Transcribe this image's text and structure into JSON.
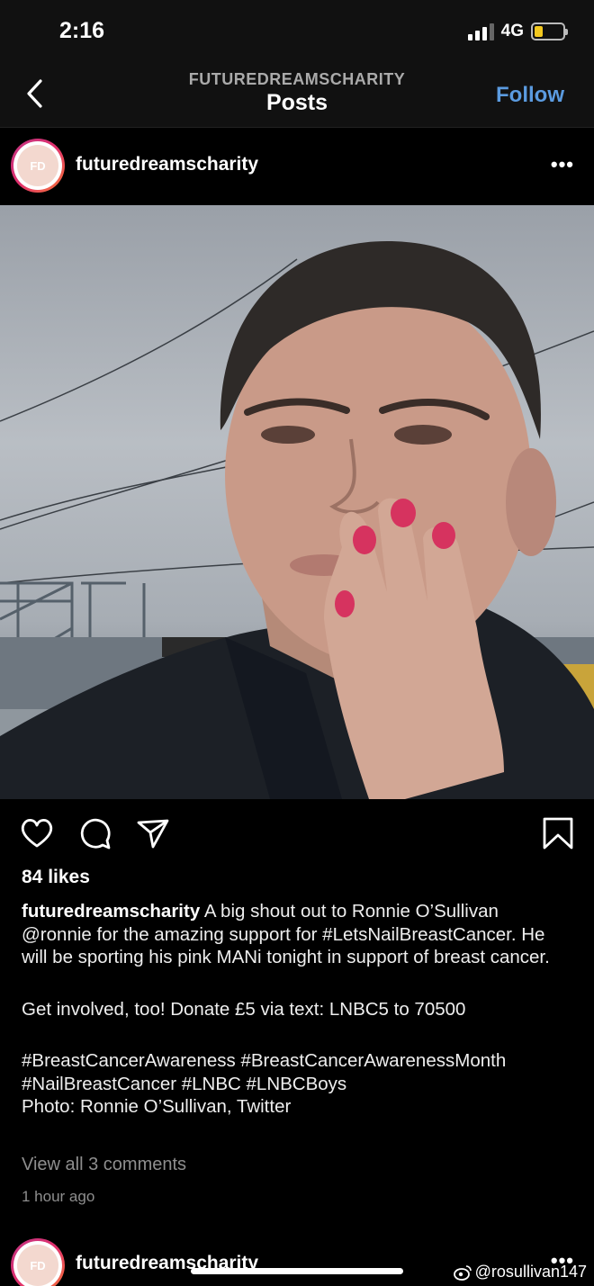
{
  "status_bar": {
    "time": "2:16",
    "network": "4G",
    "battery_level": 0.3
  },
  "nav": {
    "subtitle": "FUTUREDREAMSCHARITY",
    "title": "Posts",
    "follow_label": "Follow"
  },
  "post": {
    "username": "futuredreamscharity",
    "avatar_text": "FD",
    "more_label": "•••",
    "likes": "84 likes",
    "caption_username": "futuredreamscharity",
    "caption_line1": "A big shout out to Ronnie O’Sullivan @ronnie for the amazing support for #LetsNailBreastCancer. He will be sporting his pink MANi tonight in support of breast cancer.",
    "caption_line2": "Get involved, too! Donate £5 via text: LNBC5 to 70500",
    "caption_line3": "#BreastCancerAwareness #BreastCancerAwarenessMonth #NailBreastCancer #LNBC #LNBCBoys",
    "caption_line4": "Photo: Ronnie O’Sullivan, Twitter",
    "view_comments": "View all 3 comments",
    "timestamp": "1 hour ago"
  },
  "next_post": {
    "username": "futuredreamscharity",
    "avatar_text": "FD",
    "more_label": "•••"
  },
  "watermark": "@rosullivan147",
  "colors": {
    "accent": "#5b9be0",
    "background": "#000000",
    "nail": "#d6335f"
  },
  "icons": [
    "back-arrow-icon",
    "heart-icon",
    "comment-icon",
    "share-icon",
    "bookmark-icon",
    "more-icon",
    "weibo-icon"
  ]
}
